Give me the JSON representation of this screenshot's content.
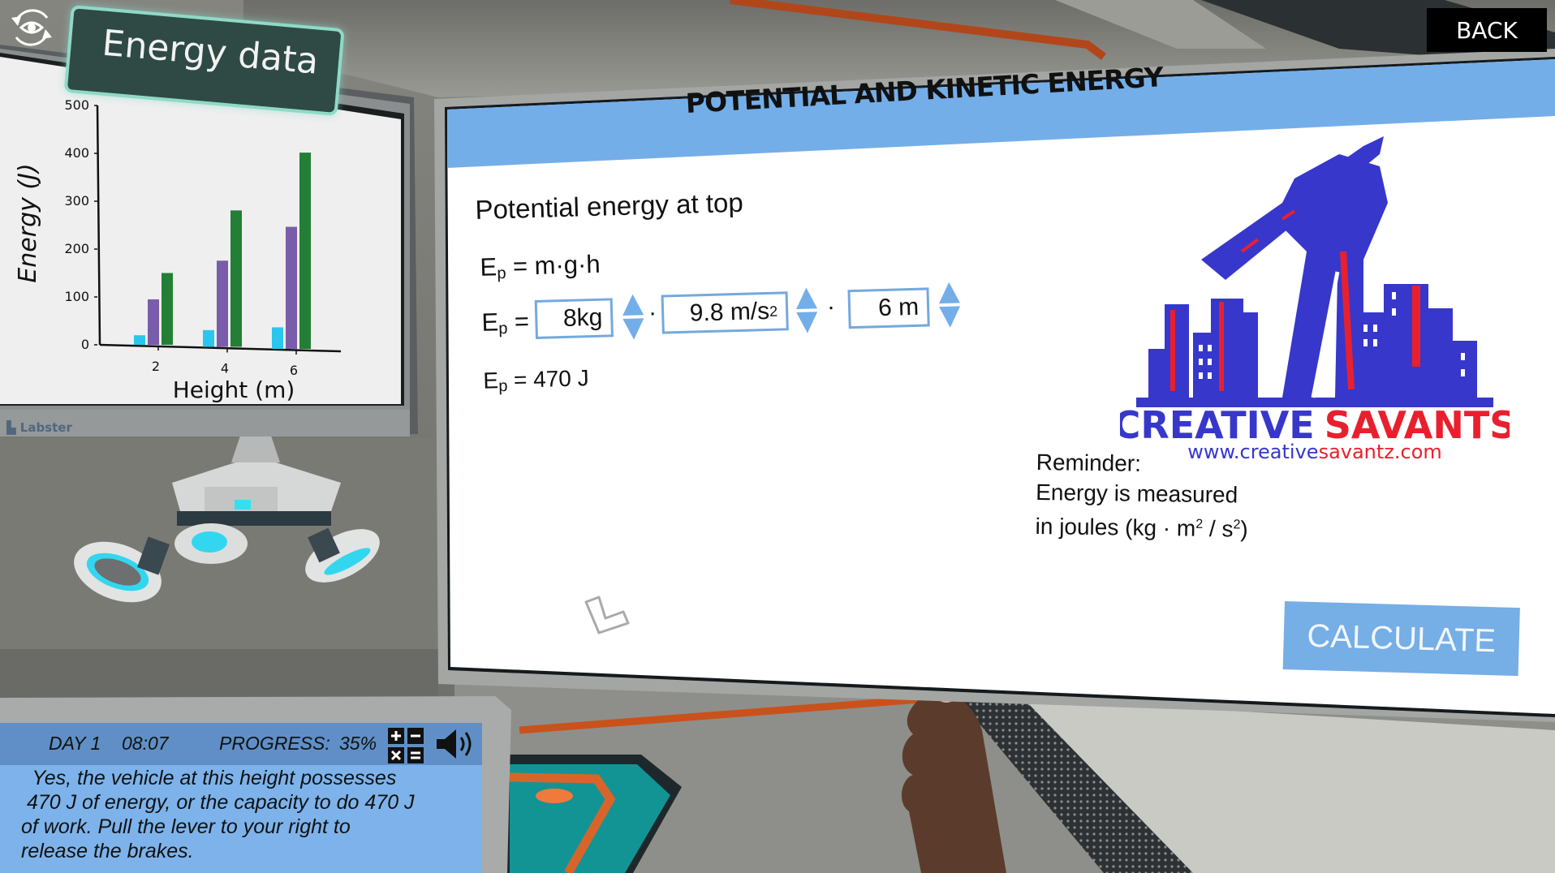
{
  "top_bar": {
    "back_label": "BACK",
    "view_toggle_icon": "eye-rotate-icon"
  },
  "chart_panel": {
    "title": "Energy data",
    "brand": "Labster"
  },
  "chart_data": {
    "type": "bar",
    "title": "Energy data",
    "xlabel": "Height (m)",
    "ylabel": "Energy (J)",
    "categories": [
      "2",
      "4",
      "6"
    ],
    "ylim": [
      0,
      500
    ],
    "yticks": [
      "0",
      "100",
      "200",
      "300",
      "400",
      "500"
    ],
    "grid": false,
    "legend": "none",
    "series": [
      {
        "name": "series-cyan",
        "color": "#2bc6ee",
        "values": [
          20,
          35,
          45
        ]
      },
      {
        "name": "series-purple",
        "color": "#7a5daa",
        "values": [
          95,
          180,
          255
        ]
      },
      {
        "name": "series-green",
        "color": "#237f35",
        "values": [
          150,
          285,
          410
        ]
      }
    ]
  },
  "main_panel": {
    "title": "POTENTIAL AND KINETIC ENERGY",
    "section_heading": "Potential energy at top",
    "formula": {
      "lhs": "E",
      "sub": "p",
      "rhs": "= m·g·h"
    },
    "equation_prefix": "=",
    "inputs": [
      {
        "name": "mass",
        "value": "8kg",
        "unit_sup": ""
      },
      {
        "name": "gravity",
        "value": "9.8  m/s",
        "unit_sup": "2"
      },
      {
        "name": "height",
        "value": "6  m",
        "unit_sup": ""
      }
    ],
    "operator": "·",
    "result": "= 470 J",
    "reminder": {
      "line1": "Reminder:",
      "line2": "Energy is measured",
      "line3_pre": "in joules (kg · m",
      "sup1": "2",
      "line3_mid": " / s",
      "sup2": "2",
      "line3_post": ")"
    },
    "calculate_label": "CALCULATE",
    "logo": {
      "name_part1": "CREATIVE",
      "name_part2": "SAVANTS",
      "url_part1": "www.creative",
      "url_part2": "savantz.com",
      "colors": {
        "blue": "#3737cc",
        "red": "#e8202e"
      }
    }
  },
  "status_bar": {
    "day": "DAY 1",
    "time": "08:07",
    "progress_label": "PROGRESS:",
    "progress_value": "35%",
    "calculator_icon": "calculator-icon",
    "sound_icon": "speaker-icon"
  },
  "dialog": {
    "message": "  Yes, the vehicle at this height possesses\n 470 J of energy, or the capacity to do 470 J\nof work. Pull the lever to your right to\nrelease the brakes."
  },
  "colors": {
    "accent_blue": "#74aee8",
    "dialog_header": "#5f8fc6",
    "dialog_body": "#7db3ea",
    "teal_frame": "#8fd9c7"
  }
}
